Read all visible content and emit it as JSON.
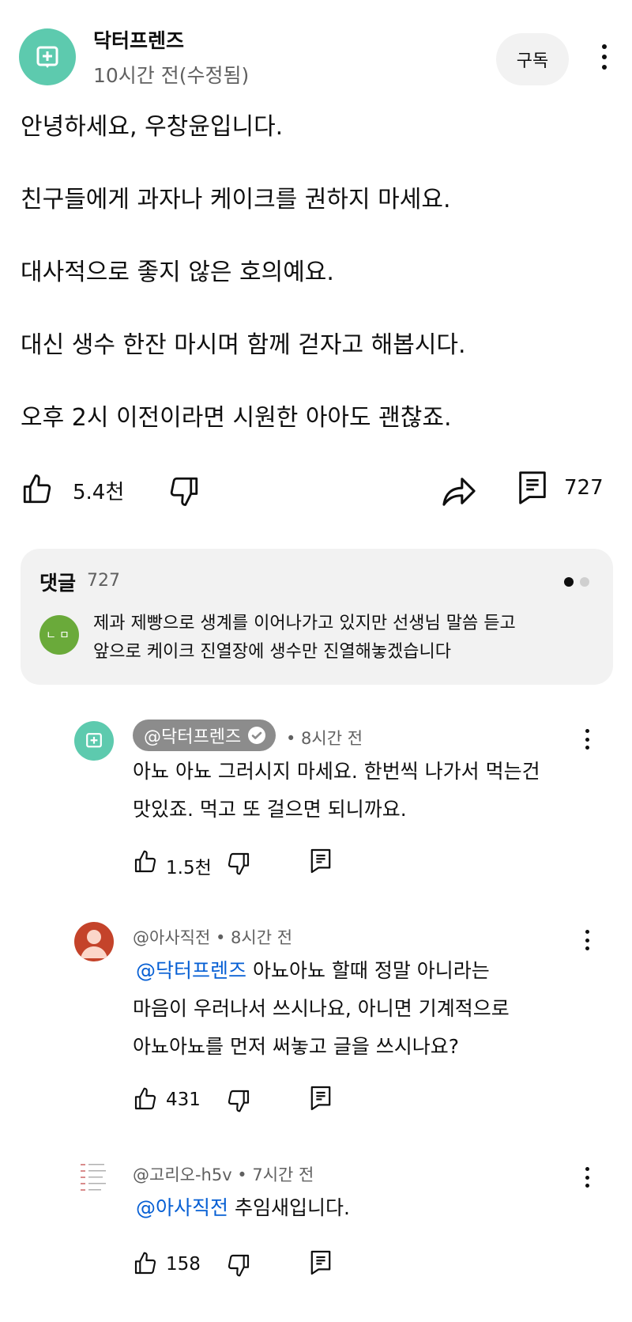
{
  "post": {
    "author": "닥터프렌즈",
    "time": "10시간 전(수정됨)",
    "subscribe_label": "구독",
    "paragraphs": [
      "안녕하세요, 우창윤입니다.",
      "친구들에게 과자나 케이크를 권하지 마세요.",
      "대사적으로 좋지 않은 호의예요.",
      "대신 생수 한잔 마시며 함께 걷자고 해봅시다.",
      "오후 2시 이전이라면 시원한 아아도 괜찮죠."
    ],
    "like_count": "5.4천",
    "comment_count": "727"
  },
  "comments": {
    "header_label": "댓글",
    "header_count": "727",
    "top_avatar_initials": "ㄴㅁ",
    "top_line1": "제과 제빵으로 생계를 이어나가고 있지만 선생님 말씀 듣고",
    "top_line2": "앞으로 케이크 진열장에 생수만 진열해놓겠습니다"
  },
  "replies": [
    {
      "author": "@닥터프렌즈",
      "verified": true,
      "time": "• 8시간 전",
      "lines": [
        "아뇨 아뇨 그러시지 마세요. 한번씩 나가서 먹는건",
        "맛있죠. 먹고 또 걸으면 되니까요."
      ],
      "likes": "1.5천"
    },
    {
      "author_meta": "@아사직전 • 8시간 전",
      "mention": "@닥터프렌즈",
      "line1_rest": " 아뇨아뇨 할때 정말 아니라는",
      "lines": [
        "마음이 우러나서 쓰시나요, 아니면 기계적으로",
        "아뇨아뇨를 먼저 써놓고 글을 쓰시나요?"
      ],
      "likes": "431"
    },
    {
      "author_meta": "@고리오-h5v • 7시간 전",
      "mention": "@아사직전",
      "line1_rest": " 추임새입니다.",
      "likes": "158"
    }
  ],
  "colors": {
    "brand_teal": "#5dcaae",
    "mention_blue": "#065fd4",
    "green_avatar": "#6aaa3a",
    "red_avatar": "#c4432a"
  }
}
